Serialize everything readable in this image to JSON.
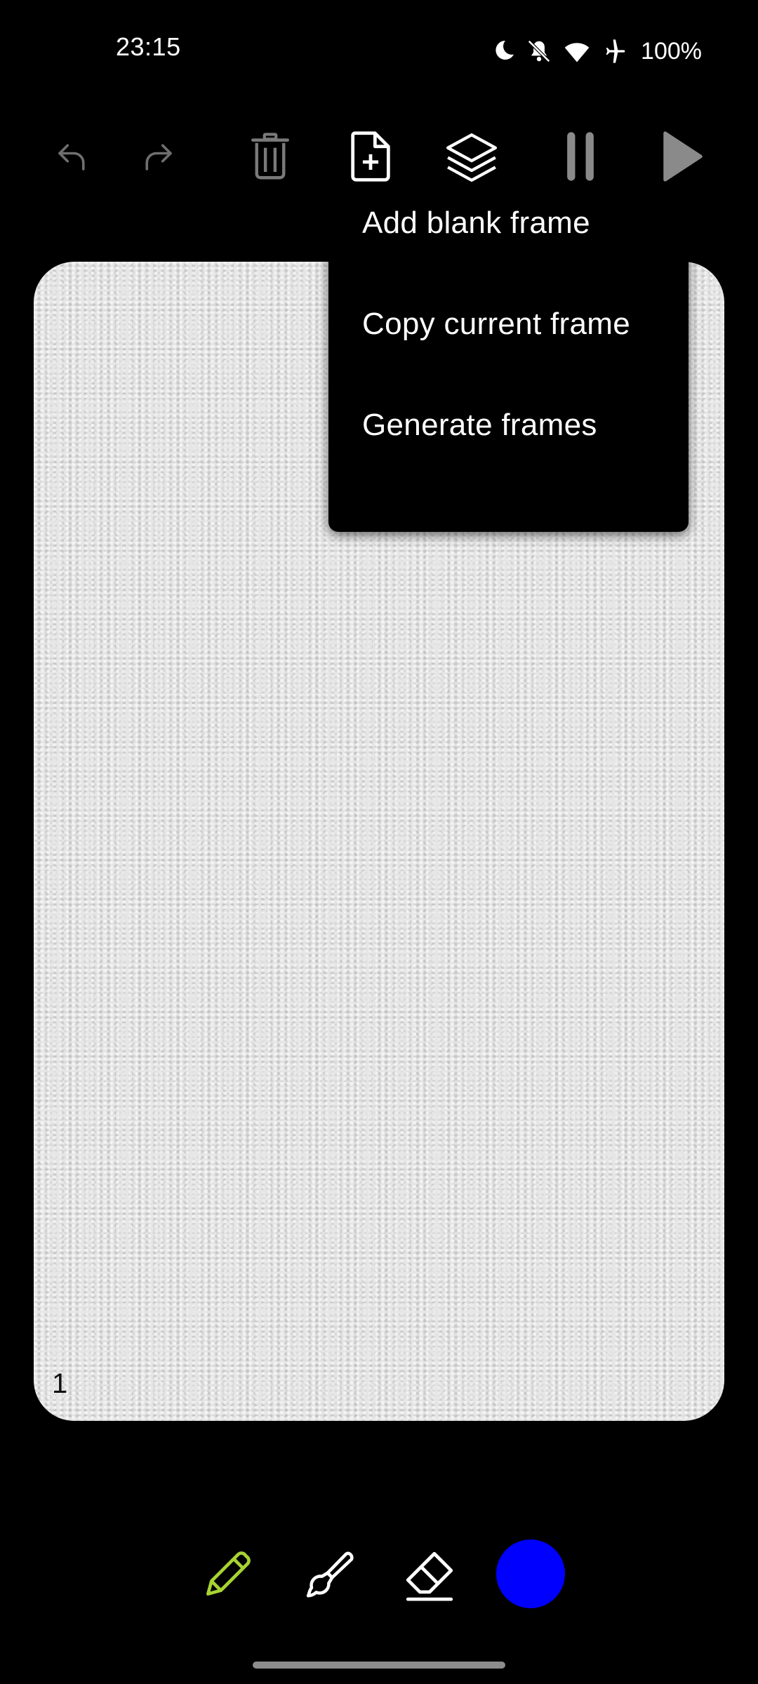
{
  "status_bar": {
    "time": "23:15",
    "battery": "100%",
    "icons": [
      "moon-icon",
      "bell-off-icon",
      "wifi-icon",
      "airplane-icon"
    ]
  },
  "toolbar": {
    "buttons": [
      "undo-icon",
      "redo-icon",
      "delete-icon",
      "add-frame-icon",
      "layers-icon",
      "pause-icon",
      "play-icon"
    ]
  },
  "menu": {
    "items": [
      {
        "label": "Add blank frame"
      },
      {
        "label": "Copy current frame"
      },
      {
        "label": "Generate frames"
      }
    ]
  },
  "canvas": {
    "frame_number": "1"
  },
  "tools": {
    "items": [
      "pencil-icon",
      "brush-icon",
      "eraser-icon"
    ],
    "selected": "pencil-icon",
    "active_color": "#0000FF",
    "pencil_color": "#a7d332"
  }
}
